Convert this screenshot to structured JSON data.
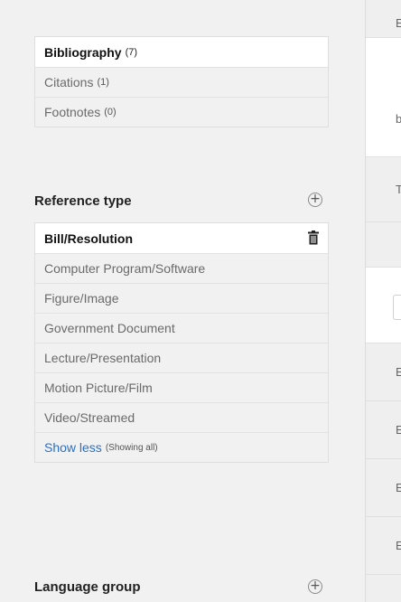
{
  "views": [
    {
      "label": "Bibliography",
      "count": "(7)",
      "active": true
    },
    {
      "label": "Citations",
      "count": "(1)",
      "active": false
    },
    {
      "label": "Footnotes",
      "count": "(0)",
      "active": false
    }
  ],
  "reference_type": {
    "title": "Reference type",
    "add_icon": "plus-circle-icon",
    "delete_icon": "trash-icon",
    "items": [
      "Bill/Resolution",
      "Computer Program/Software",
      "Figure/Image",
      "Government Document",
      "Lecture/Presentation",
      "Motion Picture/Film",
      "Video/Streamed"
    ],
    "show_less": "Show less",
    "show_hint": "(Showing all)"
  },
  "language_group": {
    "title": "Language group",
    "add_icon": "plus-circle-icon"
  },
  "right_panel": {
    "glyphs": [
      "E",
      "b",
      "T",
      "E",
      "E",
      "E",
      "E"
    ]
  }
}
